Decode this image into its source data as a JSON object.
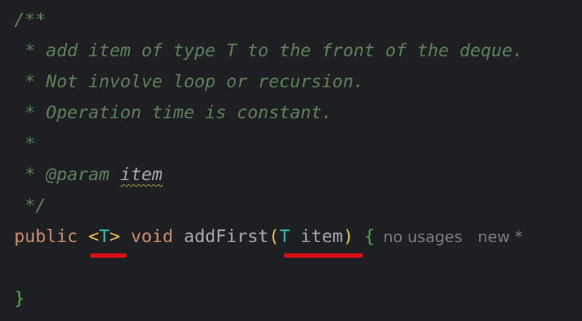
{
  "code": {
    "doc_open": "/**",
    "doc_line_1": " * add item of type T to the front of the deque.",
    "doc_line_2": " * Not involve loop or recursion.",
    "doc_line_3": " * Operation time is constant.",
    "doc_line_4": " *",
    "doc_param_prefix": " * ",
    "doc_param_tag": "@param",
    "doc_param_name": "item",
    "doc_close": " */",
    "signature": {
      "modifier": "public",
      "type_open": "<",
      "type_param": "T",
      "type_close": ">",
      "return_type": "void",
      "method_name": "addFirst",
      "paren_open": "(",
      "param_type": "T",
      "param_name": "item",
      "paren_close": ")",
      "brace_open": "{"
    },
    "closing_brace": "}"
  },
  "inlay_hints": {
    "usages": "no usages",
    "author": "new *"
  },
  "colors": {
    "background": "#1e1f22",
    "doc_comment": "#5f8259",
    "keyword": "#cf8e6d",
    "type_parameter": "#2fbfb1",
    "bracket_highlight": "#e8c547",
    "brace": "#53a651",
    "annotation_underline": "#e00d17"
  }
}
